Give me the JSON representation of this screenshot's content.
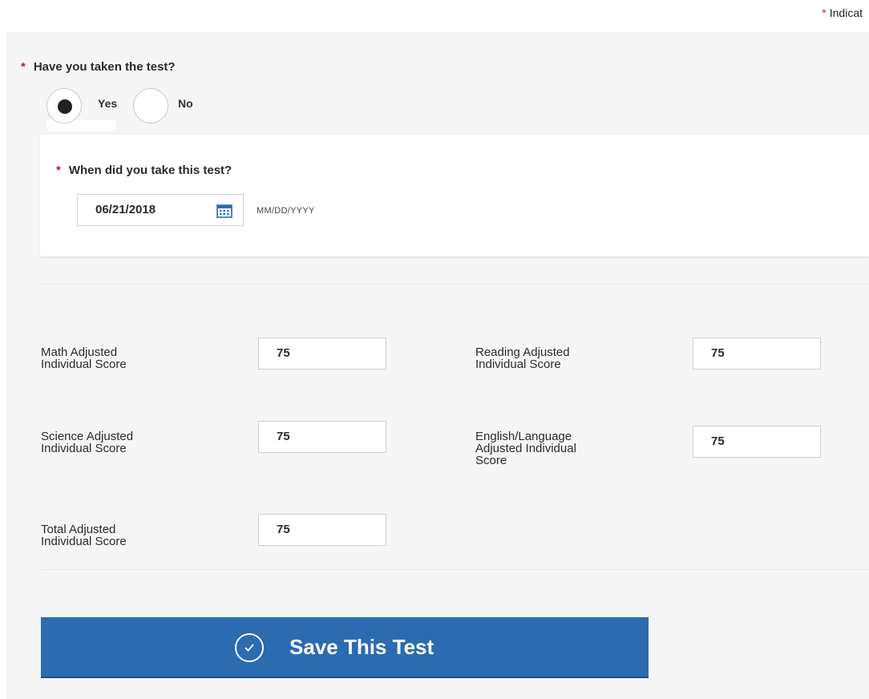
{
  "required_legend": {
    "star": "*",
    "text": "Indicat"
  },
  "question_taken": {
    "required_mark": "*",
    "label": "Have you taken the test?"
  },
  "radio": {
    "yes_label": "Yes",
    "no_label": "No",
    "selected": "Yes"
  },
  "question_date": {
    "required_mark": "*",
    "label": "When did you take this test?"
  },
  "date": {
    "value": "06/21/2018",
    "format_hint": "MM/DD/YYYY"
  },
  "scores": {
    "math": {
      "label_line1": "Math Adjusted",
      "label_line2": "Individual Score",
      "value": "75"
    },
    "reading": {
      "label_line1": "Reading Adjusted",
      "label_line2": "Individual Score",
      "value": "75"
    },
    "science": {
      "label_line1": "Science Adjusted",
      "label_line2": "Individual Score",
      "value": "75"
    },
    "english": {
      "label_line1": "English/Language",
      "label_line2": "Adjusted Individual",
      "label_line3": "Score",
      "value": "75"
    },
    "total": {
      "label_line1": "Total Adjusted",
      "label_line2": "Individual Score",
      "value": "75"
    }
  },
  "save_button": {
    "label": "Save This Test"
  },
  "colors": {
    "accent": "#2b6bb0",
    "required": "#b5213a",
    "panel": "#f5f5f5"
  },
  "icons": {
    "calendar": "calendar-icon",
    "check": "check-circle-icon"
  }
}
